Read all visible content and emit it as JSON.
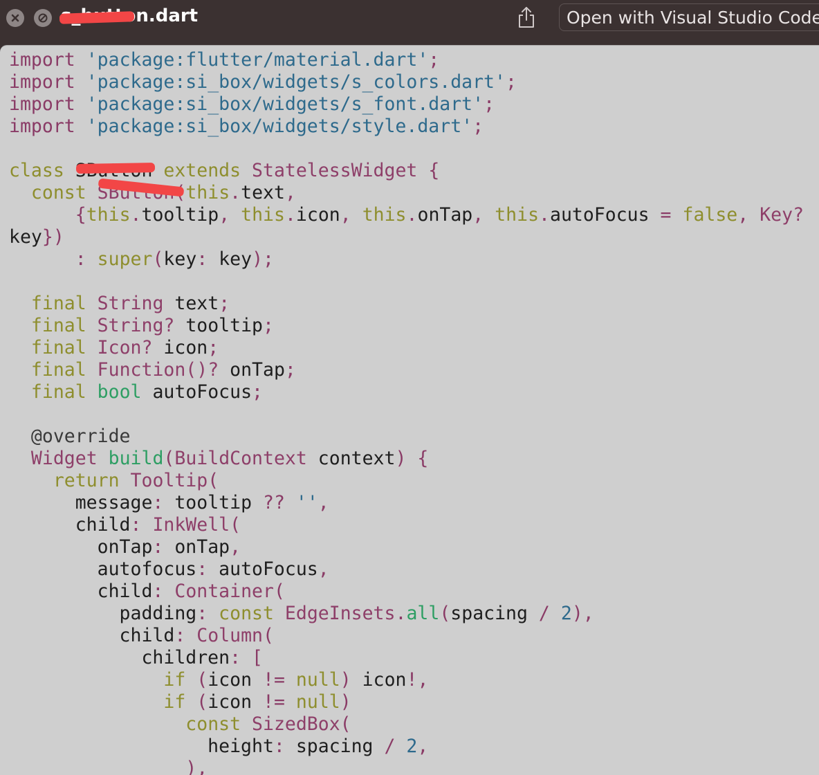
{
  "window": {
    "title": "s_button.dart",
    "open_with_label": "Open with Visual Studio Code"
  },
  "icons": {
    "close": "close-icon",
    "minimize": "stop-icon",
    "share": "share-icon"
  },
  "code_lines": [
    [
      [
        "kw",
        "import"
      ],
      [
        "t",
        " "
      ],
      [
        "st",
        "'package:flutter/material.dart'"
      ],
      [
        "pu",
        ";"
      ]
    ],
    [
      [
        "kw",
        "import"
      ],
      [
        "t",
        " "
      ],
      [
        "st",
        "'package:si_box/widgets/s_colors.dart'"
      ],
      [
        "pu",
        ";"
      ]
    ],
    [
      [
        "kw",
        "import"
      ],
      [
        "t",
        " "
      ],
      [
        "st",
        "'package:si_box/widgets/s_font.dart'"
      ],
      [
        "pu",
        ";"
      ]
    ],
    [
      [
        "kw",
        "import"
      ],
      [
        "t",
        " "
      ],
      [
        "st",
        "'package:si_box/widgets/style.dart'"
      ],
      [
        "pu",
        ";"
      ]
    ],
    [],
    [
      [
        "ctl",
        "class"
      ],
      [
        "t",
        " SButton "
      ],
      [
        "ctl",
        "extends"
      ],
      [
        "t",
        " "
      ],
      [
        "ty",
        "StatelessWidget"
      ],
      [
        "t",
        " "
      ],
      [
        "pu",
        "{"
      ]
    ],
    [
      [
        "t",
        "  "
      ],
      [
        "ctl",
        "const"
      ],
      [
        "t",
        " "
      ],
      [
        "ty",
        "SButton"
      ],
      [
        "pu",
        "("
      ],
      [
        "ctl",
        "this"
      ],
      [
        "pu",
        "."
      ],
      [
        "t",
        "text"
      ],
      [
        "pu",
        ","
      ]
    ],
    [
      [
        "t",
        "      "
      ],
      [
        "pu",
        "{"
      ],
      [
        "ctl",
        "this"
      ],
      [
        "pu",
        "."
      ],
      [
        "t",
        "tooltip"
      ],
      [
        "pu",
        ","
      ],
      [
        "t",
        " "
      ],
      [
        "ctl",
        "this"
      ],
      [
        "pu",
        "."
      ],
      [
        "t",
        "icon"
      ],
      [
        "pu",
        ","
      ],
      [
        "t",
        " "
      ],
      [
        "ctl",
        "this"
      ],
      [
        "pu",
        "."
      ],
      [
        "t",
        "onTap"
      ],
      [
        "pu",
        ","
      ],
      [
        "t",
        " "
      ],
      [
        "ctl",
        "this"
      ],
      [
        "pu",
        "."
      ],
      [
        "t",
        "autoFocus "
      ],
      [
        "pu",
        "="
      ],
      [
        "t",
        " "
      ],
      [
        "ctl",
        "false"
      ],
      [
        "pu",
        ","
      ],
      [
        "t",
        " "
      ],
      [
        "ty",
        "Key?"
      ]
    ],
    [
      [
        "t",
        "key"
      ],
      [
        "pu",
        "})"
      ]
    ],
    [
      [
        "t",
        "      "
      ],
      [
        "pu",
        ":"
      ],
      [
        "t",
        " "
      ],
      [
        "ctl",
        "super"
      ],
      [
        "pu",
        "("
      ],
      [
        "t",
        "key"
      ],
      [
        "pu",
        ":"
      ],
      [
        "t",
        " key"
      ],
      [
        "pu",
        ");"
      ]
    ],
    [],
    [
      [
        "t",
        "  "
      ],
      [
        "ctl",
        "final"
      ],
      [
        "t",
        " "
      ],
      [
        "ty",
        "String"
      ],
      [
        "t",
        " text"
      ],
      [
        "pu",
        ";"
      ]
    ],
    [
      [
        "t",
        "  "
      ],
      [
        "ctl",
        "final"
      ],
      [
        "t",
        " "
      ],
      [
        "ty",
        "String?"
      ],
      [
        "t",
        " tooltip"
      ],
      [
        "pu",
        ";"
      ]
    ],
    [
      [
        "t",
        "  "
      ],
      [
        "ctl",
        "final"
      ],
      [
        "t",
        " "
      ],
      [
        "ty",
        "Icon?"
      ],
      [
        "t",
        " icon"
      ],
      [
        "pu",
        ";"
      ]
    ],
    [
      [
        "t",
        "  "
      ],
      [
        "ctl",
        "final"
      ],
      [
        "t",
        " "
      ],
      [
        "ty",
        "Function()?"
      ],
      [
        "t",
        " onTap"
      ],
      [
        "pu",
        ";"
      ]
    ],
    [
      [
        "t",
        "  "
      ],
      [
        "ctl",
        "final"
      ],
      [
        "t",
        " "
      ],
      [
        "fn",
        "bool"
      ],
      [
        "t",
        " autoFocus"
      ],
      [
        "pu",
        ";"
      ]
    ],
    [],
    [
      [
        "t",
        "  "
      ],
      [
        "an",
        "@override"
      ]
    ],
    [
      [
        "t",
        "  "
      ],
      [
        "ty",
        "Widget"
      ],
      [
        "t",
        " "
      ],
      [
        "fn",
        "build"
      ],
      [
        "pu",
        "("
      ],
      [
        "ty",
        "BuildContext"
      ],
      [
        "t",
        " context"
      ],
      [
        "pu",
        ")"
      ],
      [
        "t",
        " "
      ],
      [
        "pu",
        "{"
      ]
    ],
    [
      [
        "t",
        "    "
      ],
      [
        "ctl",
        "return"
      ],
      [
        "t",
        " "
      ],
      [
        "ty",
        "Tooltip"
      ],
      [
        "pu",
        "("
      ]
    ],
    [
      [
        "t",
        "      message"
      ],
      [
        "pu",
        ":"
      ],
      [
        "t",
        " tooltip "
      ],
      [
        "pu",
        "??"
      ],
      [
        "t",
        " "
      ],
      [
        "st",
        "''"
      ],
      [
        "pu",
        ","
      ]
    ],
    [
      [
        "t",
        "      child"
      ],
      [
        "pu",
        ":"
      ],
      [
        "t",
        " "
      ],
      [
        "ty",
        "InkWell"
      ],
      [
        "pu",
        "("
      ]
    ],
    [
      [
        "t",
        "        onTap"
      ],
      [
        "pu",
        ":"
      ],
      [
        "t",
        " onTap"
      ],
      [
        "pu",
        ","
      ]
    ],
    [
      [
        "t",
        "        autofocus"
      ],
      [
        "pu",
        ":"
      ],
      [
        "t",
        " autoFocus"
      ],
      [
        "pu",
        ","
      ]
    ],
    [
      [
        "t",
        "        child"
      ],
      [
        "pu",
        ":"
      ],
      [
        "t",
        " "
      ],
      [
        "ty",
        "Container"
      ],
      [
        "pu",
        "("
      ]
    ],
    [
      [
        "t",
        "          padding"
      ],
      [
        "pu",
        ":"
      ],
      [
        "t",
        " "
      ],
      [
        "ctl",
        "const"
      ],
      [
        "t",
        " "
      ],
      [
        "ty",
        "EdgeInsets"
      ],
      [
        "pu",
        "."
      ],
      [
        "fn",
        "all"
      ],
      [
        "pu",
        "("
      ],
      [
        "t",
        "spacing "
      ],
      [
        "pu",
        "/"
      ],
      [
        "t",
        " "
      ],
      [
        "num",
        "2"
      ],
      [
        "pu",
        "),"
      ]
    ],
    [
      [
        "t",
        "          child"
      ],
      [
        "pu",
        ":"
      ],
      [
        "t",
        " "
      ],
      [
        "ty",
        "Column"
      ],
      [
        "pu",
        "("
      ]
    ],
    [
      [
        "t",
        "            children"
      ],
      [
        "pu",
        ":"
      ],
      [
        "t",
        " "
      ],
      [
        "pu",
        "["
      ]
    ],
    [
      [
        "t",
        "              "
      ],
      [
        "ctl",
        "if"
      ],
      [
        "t",
        " "
      ],
      [
        "pu",
        "("
      ],
      [
        "t",
        "icon "
      ],
      [
        "pu",
        "!="
      ],
      [
        "t",
        " "
      ],
      [
        "ctl",
        "null"
      ],
      [
        "pu",
        ")"
      ],
      [
        "t",
        " icon"
      ],
      [
        "pu",
        "!,"
      ]
    ],
    [
      [
        "t",
        "              "
      ],
      [
        "ctl",
        "if"
      ],
      [
        "t",
        " "
      ],
      [
        "pu",
        "("
      ],
      [
        "t",
        "icon "
      ],
      [
        "pu",
        "!="
      ],
      [
        "t",
        " "
      ],
      [
        "ctl",
        "null"
      ],
      [
        "pu",
        ")"
      ]
    ],
    [
      [
        "t",
        "                "
      ],
      [
        "ctl",
        "const"
      ],
      [
        "t",
        " "
      ],
      [
        "ty",
        "SizedBox"
      ],
      [
        "pu",
        "("
      ]
    ],
    [
      [
        "t",
        "                  height"
      ],
      [
        "pu",
        ":"
      ],
      [
        "t",
        " spacing "
      ],
      [
        "pu",
        "/"
      ],
      [
        "t",
        " "
      ],
      [
        "num",
        "2"
      ],
      [
        "pu",
        ","
      ]
    ],
    [
      [
        "t",
        "                "
      ],
      [
        "pu",
        "),"
      ]
    ]
  ]
}
